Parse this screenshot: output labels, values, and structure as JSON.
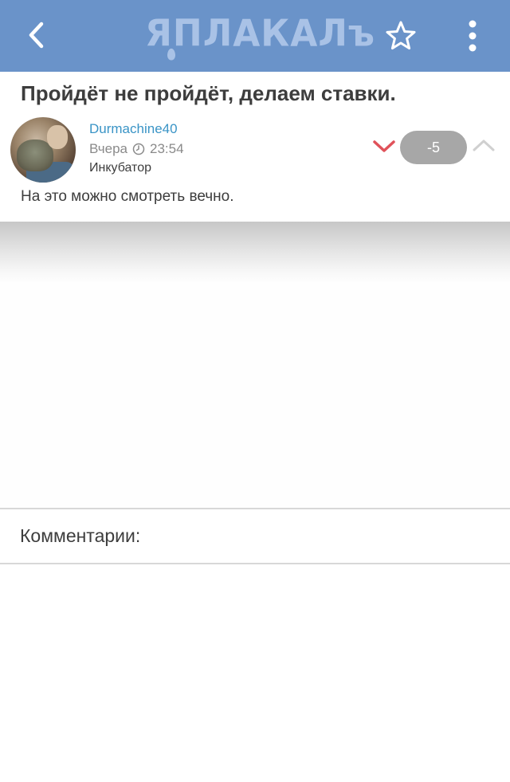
{
  "header": {
    "logo_text": "ЯПЛАКАЛъ",
    "back_icon": "chevron-left-icon",
    "favorite_icon": "star-outline-icon",
    "menu_icon": "vertical-dots-icon",
    "background_color": "#6a93c9"
  },
  "post": {
    "title": "Пройдёт не пройдёт, делаем ставки.",
    "author": "Durmachine40",
    "date_label": "Вчера",
    "time": "23:54",
    "rank": "Инкубатор",
    "score": "-5",
    "body": "На это можно смотреть вечно.",
    "colors": {
      "author": "#3a94c6",
      "vote_down": "#e0525a",
      "vote_up": "#d0d0d0",
      "score_bg": "#a7a7a7"
    }
  },
  "comments": {
    "title": "Комментарии:"
  }
}
